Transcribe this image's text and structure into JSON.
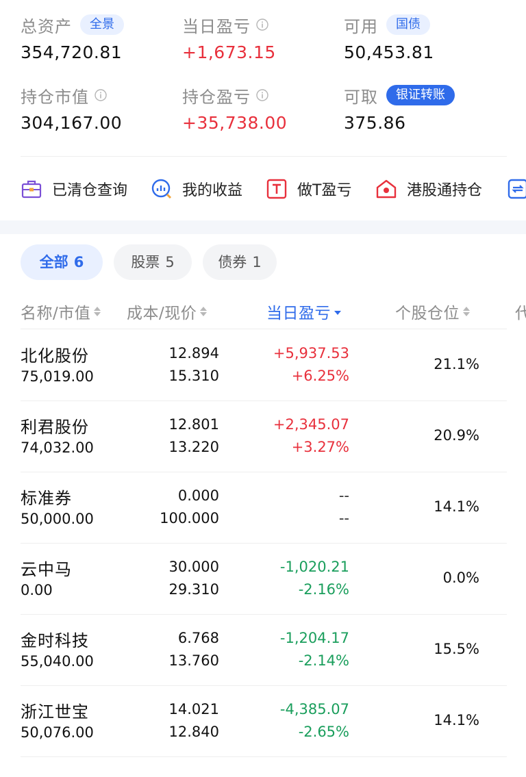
{
  "summary": {
    "total_assets": {
      "label": "总资产",
      "badge": "全景",
      "value": "354,720.81"
    },
    "daily_pl": {
      "label": "当日盈亏",
      "value": "+1,673.15"
    },
    "available": {
      "label": "可用",
      "badge": "国债",
      "value": "50,453.81"
    },
    "position_value": {
      "label": "持仓市值",
      "value": "304,167.00"
    },
    "position_pl": {
      "label": "持仓盈亏",
      "value": "+35,738.00"
    },
    "withdrawable": {
      "label": "可取",
      "badge": "银证转账",
      "value": "375.86"
    }
  },
  "shortcuts": [
    {
      "label": "已清仓查询",
      "icon": "briefcase-icon"
    },
    {
      "label": "我的收益",
      "icon": "chart-search-icon"
    },
    {
      "label": "做T盈亏",
      "icon": "t-box-icon"
    },
    {
      "label": "港股通持仓",
      "icon": "hk-house-icon"
    }
  ],
  "filters": [
    {
      "label": "全部",
      "count": "6",
      "active": true
    },
    {
      "label": "股票",
      "count": "5",
      "active": false
    },
    {
      "label": "债券",
      "count": "1",
      "active": false
    }
  ],
  "columns": {
    "name": "名称/市值",
    "cost": "成本/现价",
    "daily_pl": "当日盈亏",
    "weight": "个股仓位",
    "more": "代"
  },
  "positions": [
    {
      "name": "北化股份",
      "market_value": "75,019.00",
      "cost": "12.894",
      "price": "15.310",
      "pl": "+5,937.53",
      "pl_pct": "+6.25%",
      "weight": "21.1%",
      "trend": "red"
    },
    {
      "name": "利君股份",
      "market_value": "74,032.00",
      "cost": "12.801",
      "price": "13.220",
      "pl": "+2,345.07",
      "pl_pct": "+3.27%",
      "weight": "20.9%",
      "trend": "red"
    },
    {
      "name": "标准券",
      "market_value": "50,000.00",
      "cost": "0.000",
      "price": "100.000",
      "pl": "--",
      "pl_pct": "--",
      "weight": "14.1%",
      "trend": "neutral"
    },
    {
      "name": "云中马",
      "market_value": "0.00",
      "cost": "30.000",
      "price": "29.310",
      "pl": "-1,020.21",
      "pl_pct": "-2.16%",
      "weight": "0.0%",
      "trend": "green"
    },
    {
      "name": "金时科技",
      "market_value": "55,040.00",
      "cost": "6.768",
      "price": "13.760",
      "pl": "-1,204.17",
      "pl_pct": "-2.14%",
      "weight": "15.5%",
      "trend": "green"
    },
    {
      "name": "浙江世宝",
      "market_value": "50,076.00",
      "cost": "14.021",
      "price": "12.840",
      "pl": "-4,385.07",
      "pl_pct": "-2.65%",
      "weight": "14.1%",
      "trend": "green"
    }
  ],
  "colors": {
    "accent": "#2f6bea",
    "up": "#e8303c",
    "down": "#1a9e5c"
  }
}
